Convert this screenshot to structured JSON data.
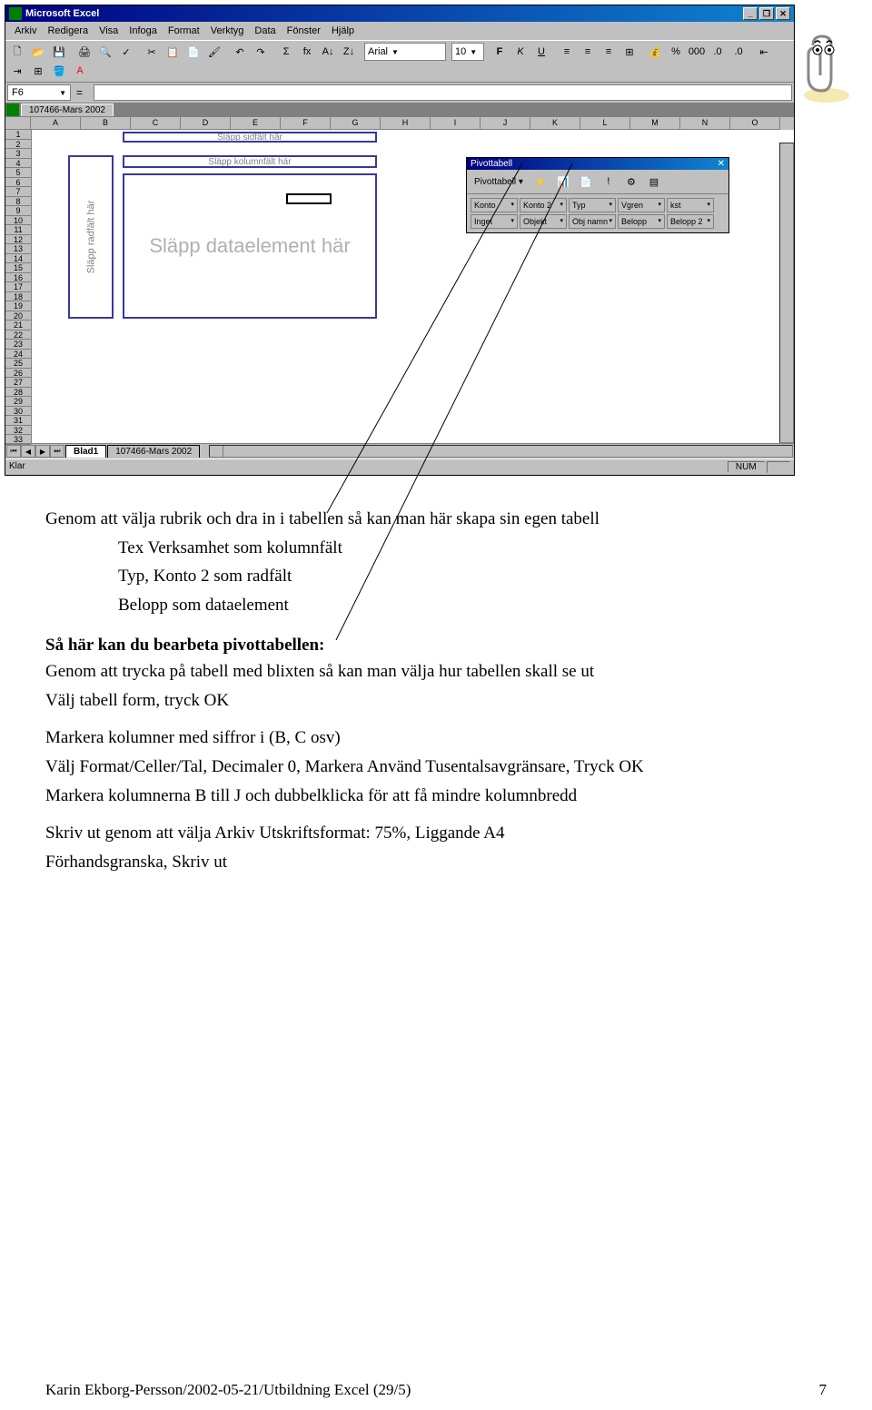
{
  "app_title": "Microsoft Excel",
  "menus": [
    "Arkiv",
    "Redigera",
    "Visa",
    "Infoga",
    "Format",
    "Verktyg",
    "Data",
    "Fönster",
    "Hjälp"
  ],
  "font_name": "Arial",
  "font_size": "10",
  "namebox": "F6",
  "formula_prefix": "=",
  "doc_tab": "107466-Mars 2002",
  "columns": [
    "A",
    "B",
    "C",
    "D",
    "E",
    "F",
    "G",
    "H",
    "I",
    "J",
    "K",
    "L",
    "M",
    "N",
    "O"
  ],
  "rows": [
    "1",
    "2",
    "3",
    "4",
    "5",
    "6",
    "7",
    "8",
    "9",
    "10",
    "11",
    "12",
    "13",
    "14",
    "15",
    "16",
    "17",
    "18",
    "19",
    "20",
    "21",
    "22",
    "23",
    "24",
    "25",
    "26",
    "27",
    "28",
    "29",
    "30",
    "31",
    "32",
    "33"
  ],
  "pivot": {
    "page_hint": "Släpp sidfält här",
    "col_hint": "Släpp kolumnfält här",
    "row_hint": "Släpp radfält här",
    "data_hint": "Släpp dataelement här",
    "toolbar_title": "Pivottabell",
    "toolbar_btn": "Pivottabell",
    "fields": [
      "Konto",
      "Konto 2",
      "Typ",
      "Vgren",
      "kst",
      "Inget",
      "Objekt",
      "Obj namn",
      "Belopp",
      "Belopp 2"
    ]
  },
  "sheet_tabs": {
    "active": "Blad1",
    "inactive": "107466-Mars 2002"
  },
  "status": {
    "ready": "Klar",
    "num": "NUM"
  },
  "doc": {
    "p1": "Genom att välja rubrik och dra in i tabellen så kan man här skapa sin egen tabell",
    "p1a": "Tex Verksamhet som kolumnfält",
    "p1b": "Typ, Konto 2 som radfält",
    "p1c": "Belopp som dataelement",
    "h2": "Så här kan du bearbeta pivottabellen:",
    "p2a": "Genom att trycka på tabell med blixten så kan man välja hur tabellen skall se ut",
    "p2b": "Välj tabell form, tryck OK",
    "p3a": "Markera kolumner med siffror i (B, C osv)",
    "p3b": "Välj  Format/Celler/Tal, Decimaler 0, Markera Använd Tusentalsavgränsare, Tryck OK",
    "p3c": "Markera kolumnerna B till J och dubbelklicka för att få mindre kolumnbredd",
    "p4a": "Skriv ut genom att välja Arkiv Utskriftsformat: 75%, Liggande A4",
    "p4b": "Förhandsgranska, Skriv ut"
  },
  "footer": {
    "left": "Karin Ekborg-Persson/2002-05-21/Utbildning Excel (29/5)",
    "right": "7"
  }
}
